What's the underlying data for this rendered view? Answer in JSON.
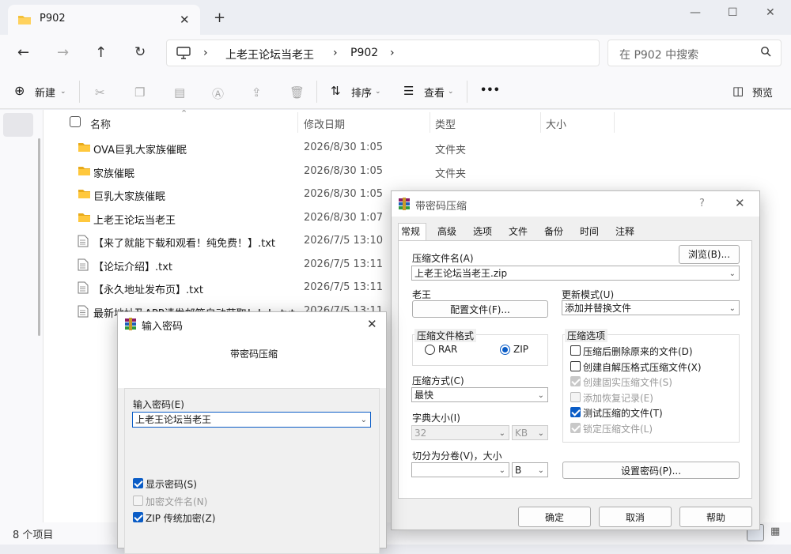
{
  "explorer": {
    "tab_title": "P902",
    "breadcrumb": [
      "上老王论坛当老王",
      "P902"
    ],
    "search_placeholder": "在 P902 中搜索",
    "toolbar": {
      "new": "新建",
      "sort": "排序",
      "view": "查看",
      "more": "•••",
      "preview": "预览"
    },
    "columns": {
      "name": "名称",
      "date": "修改日期",
      "type": "类型",
      "size": "大小"
    },
    "files": [
      {
        "name": "OVA巨乳大家族催眠",
        "date": "2026/8/30 1:05",
        "type": "文件夹",
        "kind": "folder"
      },
      {
        "name": "家族催眠",
        "date": "2026/8/30 1:05",
        "type": "文件夹",
        "kind": "folder"
      },
      {
        "name": "巨乳大家族催眠",
        "date": "2026/8/30 1:05",
        "type": "文件夹",
        "kind": "folder"
      },
      {
        "name": "上老王论坛当老王",
        "date": "2026/8/30 1:07",
        "type": "",
        "kind": "folder"
      },
      {
        "name": "【来了就能下载和观看！纯免费！】.txt",
        "date": "2026/7/5 13:10",
        "type": "",
        "kind": "file"
      },
      {
        "name": "【论坛介绍】.txt",
        "date": "2026/7/5 13:11",
        "type": "",
        "kind": "file"
      },
      {
        "name": "【永久地址发布页】.txt",
        "date": "2026/7/5 13:11",
        "type": "",
        "kind": "file"
      },
      {
        "name": "最新地址及APP请发邮箱自动获取！！！.txt",
        "date": "2026/7/5 13:11",
        "type": "",
        "kind": "file"
      }
    ],
    "status": "8 个项目"
  },
  "archive_dialog": {
    "title": "带密码压缩",
    "help": "?",
    "tabs": [
      "常规",
      "高级",
      "选项",
      "文件",
      "备份",
      "时间",
      "注释"
    ],
    "filename_label": "压缩文件名(A)",
    "browse": "浏览(B)...",
    "filename_value": "上老王论坛当老王.zip",
    "profile_label": "老王",
    "profile_button": "配置文件(F)...",
    "update_label": "更新模式(U)",
    "update_value": "添加并替换文件",
    "format_label": "压缩文件格式",
    "format_rar": "RAR",
    "format_zip": "ZIP",
    "method_label": "压缩方式(C)",
    "method_value": "最快",
    "dict_label": "字典大小(I)",
    "dict_value": "32",
    "dict_unit": "KB",
    "split_label": "切分为分卷(V)，大小",
    "split_unit": "B",
    "options_label": "压缩选项",
    "options": [
      {
        "label": "压缩后删除原来的文件(D)",
        "checked": false,
        "disabled": false
      },
      {
        "label": "创建自解压格式压缩文件(X)",
        "checked": false,
        "disabled": false
      },
      {
        "label": "创建固实压缩文件(S)",
        "checked": true,
        "disabled": true
      },
      {
        "label": "添加恢复记录(E)",
        "checked": false,
        "disabled": true
      },
      {
        "label": "测试压缩的文件(T)",
        "checked": true,
        "disabled": false
      },
      {
        "label": "锁定压缩文件(L)",
        "checked": true,
        "disabled": true
      }
    ],
    "set_password": "设置密码(P)...",
    "ok": "确定",
    "cancel": "取消",
    "helpbtn": "帮助"
  },
  "password_dialog": {
    "title": "输入密码",
    "subtitle": "带密码压缩",
    "input_label": "输入密码(E)",
    "input_value": "上老王论坛当老王",
    "show_password": "显示密码(S)",
    "encrypt_names": "加密文件名(N)",
    "zip_legacy": "ZIP 传统加密(Z)"
  }
}
